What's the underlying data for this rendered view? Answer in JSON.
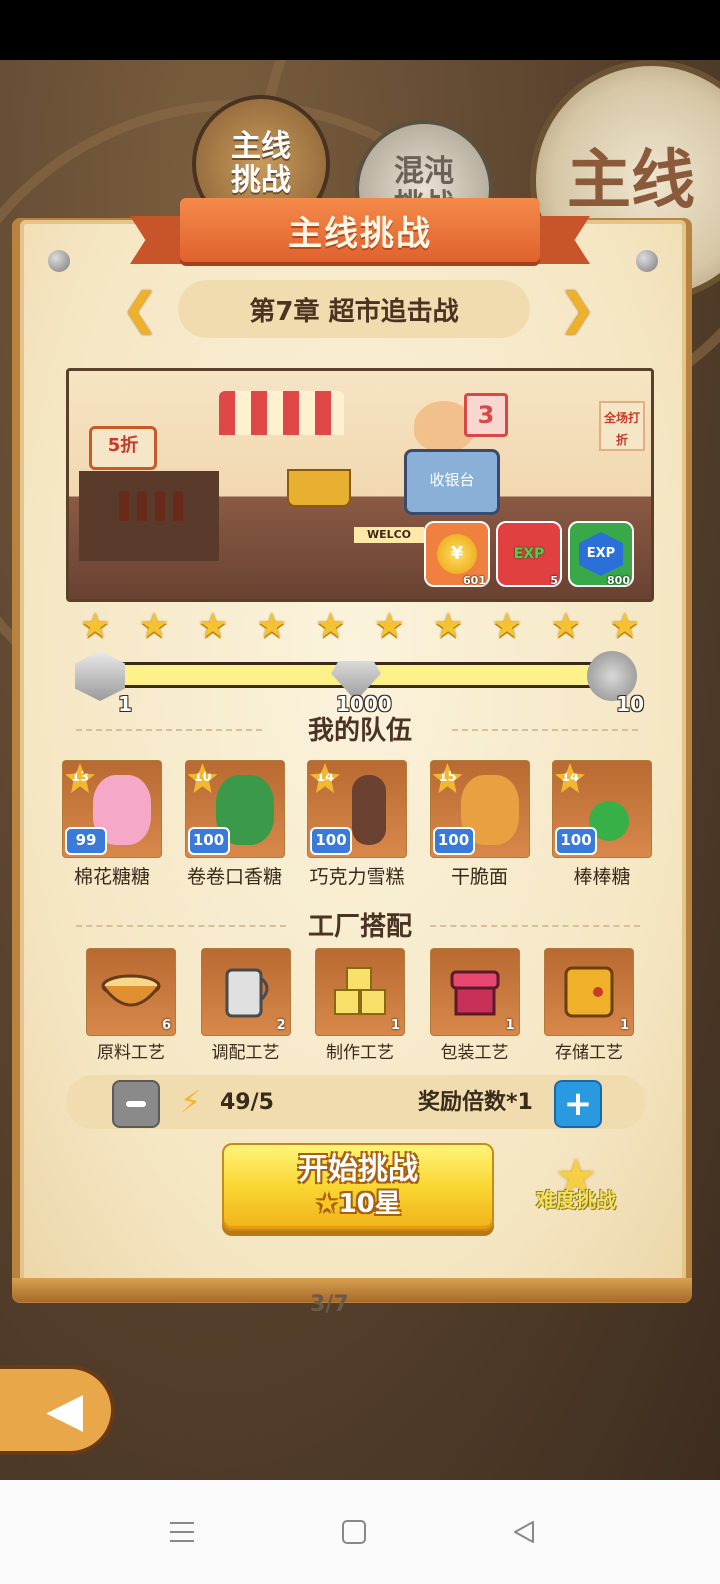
{
  "top_tabs": {
    "main_small": "主线\n挑战",
    "chaos": "混沌\n挑战",
    "main_big": "主线"
  },
  "header": {
    "title": "主线挑战"
  },
  "chapter": {
    "title": "第7章 超市追击战"
  },
  "scene": {
    "sale_sign": "5折",
    "register_label": "收银台",
    "sign_number": "3",
    "welcome_text": "WELCO",
    "discount_sign": "全场打折"
  },
  "rewards": [
    {
      "icon": "coin-icon",
      "symbol": "¥",
      "count": "601"
    },
    {
      "icon": "shop-exp-icon",
      "symbol": "EXP",
      "count": "5"
    },
    {
      "icon": "exp-icon",
      "symbol": "EXP",
      "count": "800"
    }
  ],
  "stars": {
    "count": 10
  },
  "progress": {
    "milestones": [
      {
        "icon": "silver-box-icon",
        "value": "1"
      },
      {
        "icon": "diamond-icon",
        "value": "1000"
      },
      {
        "icon": "silver-coin-icon",
        "value": "10"
      }
    ]
  },
  "team": {
    "title": "我的队伍",
    "members": [
      {
        "name": "棉花糖糖",
        "level": "13",
        "count": "99",
        "color": "#f6a8c8"
      },
      {
        "name": "卷卷口香糖",
        "level": "10",
        "count": "100",
        "color": "#3a9a4a"
      },
      {
        "name": "巧克力雪糕",
        "level": "14",
        "count": "100",
        "color": "#6a4030"
      },
      {
        "name": "干脆面",
        "level": "15",
        "count": "100",
        "color": "#e8a040"
      },
      {
        "name": "棒棒糖",
        "level": "14",
        "count": "100",
        "color": "#38b048"
      }
    ]
  },
  "factory": {
    "title": "工厂搭配",
    "items": [
      {
        "name": "原料工艺",
        "count": "6",
        "icon": "bowl-icon"
      },
      {
        "name": "调配工艺",
        "count": "2",
        "icon": "measuring-cup-icon"
      },
      {
        "name": "制作工艺",
        "count": "1",
        "icon": "butter-cubes-icon"
      },
      {
        "name": "包装工艺",
        "count": "1",
        "icon": "box-icon"
      },
      {
        "name": "存储工艺",
        "count": "1",
        "icon": "safe-icon"
      }
    ]
  },
  "energy": {
    "value": "49/5",
    "reward_multiplier": "奖励倍数*1"
  },
  "start_button": {
    "label": "开始挑战",
    "cost": "10星"
  },
  "hard_challenge": {
    "label": "难度挑战"
  },
  "pager": {
    "text": "3/7"
  },
  "colors": {
    "accent_orange": "#e0622e",
    "button_yellow": "#f9d632",
    "plus_blue": "#2a9ae0"
  }
}
